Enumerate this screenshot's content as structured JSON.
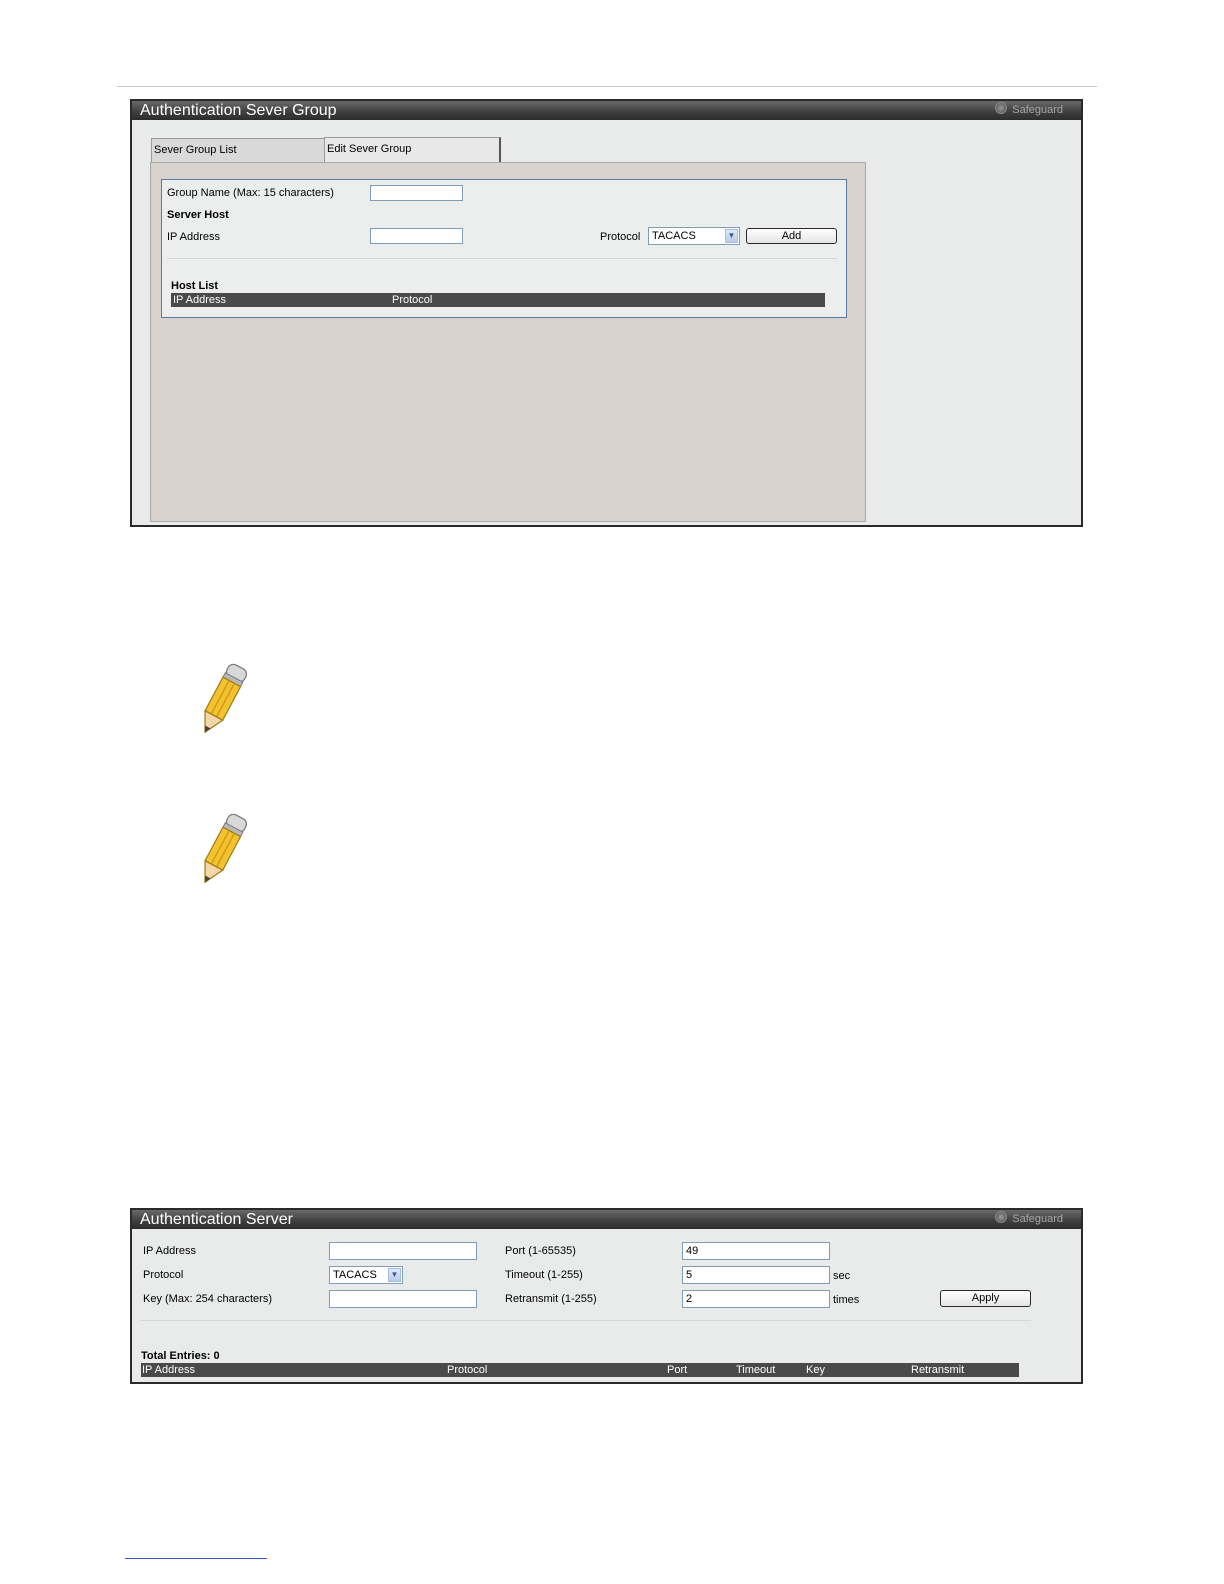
{
  "panel1": {
    "title": "Authentication Sever Group",
    "safeguard": "Safeguard",
    "tabs": [
      {
        "label": "Sever Group List",
        "active": false
      },
      {
        "label": "Edit Sever Group",
        "active": true
      }
    ],
    "group_name_label": "Group Name  (Max: 15 characters)",
    "group_name_value": "",
    "server_host_label": "Server Host",
    "ip_address_label": "IP Address",
    "ip_address_value": "",
    "protocol_label": "Protocol",
    "protocol_selected": "TACACS",
    "add_label": "Add",
    "host_list_label": "Host List",
    "host_list_columns": [
      "IP Address",
      "Protocol"
    ]
  },
  "panel2": {
    "title": "Authentication Server",
    "safeguard": "Safeguard",
    "ip_address_label": "IP Address",
    "ip_address_value": "",
    "protocol_label": "Protocol",
    "protocol_selected": "TACACS",
    "key_label": "Key (Max: 254 characters)",
    "key_value": "",
    "port_label": "Port (1-65535)",
    "port_value": "49",
    "timeout_label": "Timeout (1-255)",
    "timeout_value": "5",
    "timeout_unit": "sec",
    "retransmit_label": "Retransmit (1-255)",
    "retransmit_value": "2",
    "retransmit_unit": "times",
    "apply_label": "Apply",
    "total_entries_label": "Total Entries: 0",
    "table_columns": [
      "IP Address",
      "Protocol",
      "Port",
      "Timeout",
      "Key",
      "Retransmit"
    ]
  },
  "icons": {
    "note_icon_1": "pencil-icon",
    "note_icon_2": "pencil-icon"
  }
}
